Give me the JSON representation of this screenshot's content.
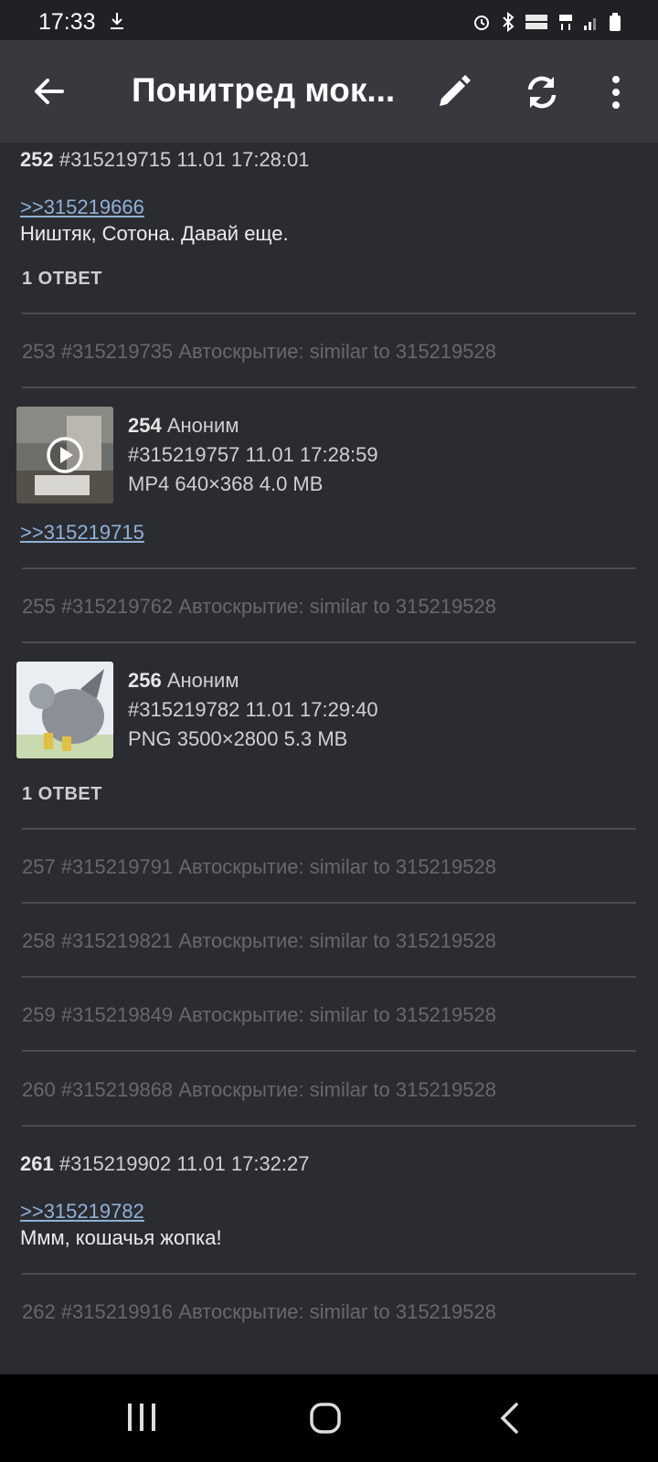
{
  "status": {
    "time": "17:33"
  },
  "appbar": {
    "title": "Понитред мок..."
  },
  "posts": [
    {
      "type": "post",
      "num": "252",
      "id": "#315219715",
      "date": "11.01 17:28:01",
      "link": ">>315219666",
      "text": "Ништяк, Сотона. Давай еще.",
      "replies": "1 ОТВЕТ"
    },
    {
      "type": "hidden",
      "text": "253 #315219735 Автоскрытие: similar to 315219528"
    },
    {
      "type": "media",
      "num": "254",
      "author": "Аноним",
      "id_date": "#315219757 11.01 17:28:59",
      "file": "MP4 640×368 4.0 MB",
      "link": ">>315219715"
    },
    {
      "type": "hidden",
      "text": "255 #315219762 Автоскрытие: similar to 315219528"
    },
    {
      "type": "media",
      "num": "256",
      "author": "Аноним",
      "id_date": "#315219782 11.01 17:29:40",
      "file": "PNG 3500×2800 5.3 MB",
      "replies": "1 ОТВЕТ"
    },
    {
      "type": "hidden",
      "text": "257 #315219791 Автоскрытие: similar to 315219528"
    },
    {
      "type": "hidden",
      "text": "258 #315219821 Автоскрытие: similar to 315219528"
    },
    {
      "type": "hidden",
      "text": "259 #315219849 Автоскрытие: similar to 315219528"
    },
    {
      "type": "hidden",
      "text": "260 #315219868 Автоскрытие: similar to 315219528"
    },
    {
      "type": "post",
      "num": "261",
      "id": "#315219902",
      "date": "11.01 17:32:27",
      "link": ">>315219782",
      "text": "Ммм, кошачья жопка!"
    },
    {
      "type": "hidden",
      "text": "262 #315219916 Автоскрытие: similar to 315219528"
    }
  ]
}
